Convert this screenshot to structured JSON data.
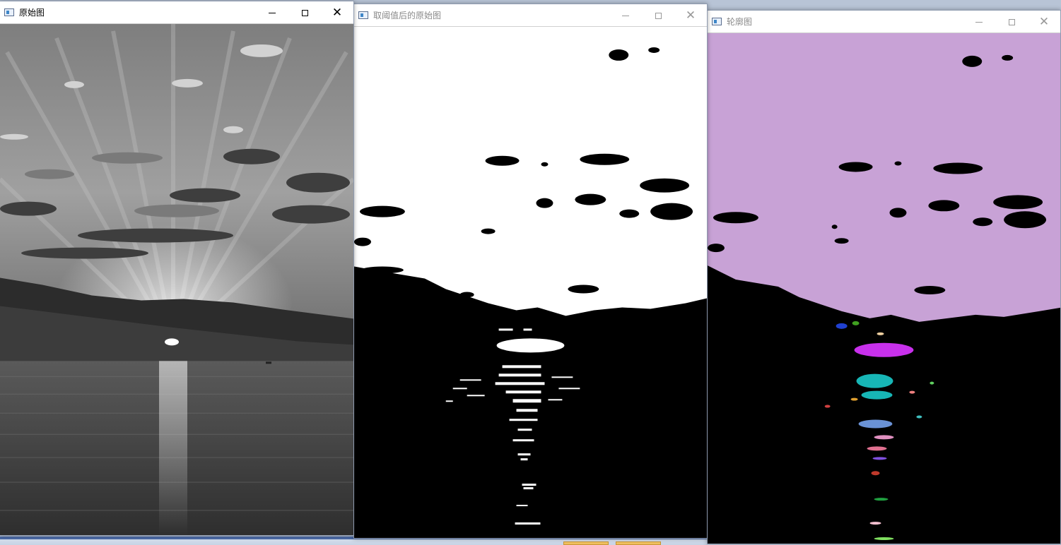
{
  "windows": [
    {
      "title": "原始图",
      "state": "active",
      "content": "grayscale-sunset-photo"
    },
    {
      "title": "取阈值后的原始图",
      "state": "inactive",
      "content": "binary-threshold-image"
    },
    {
      "title": "轮廓图",
      "state": "inactive",
      "content": "contour-colored-image"
    }
  ],
  "controls": {
    "minimize": "—",
    "maximize": "☐",
    "close": "✕"
  },
  "icons": {
    "app": "app-window-icon",
    "minimize": "minimize-icon",
    "maximize": "maximize-icon",
    "close": "close-icon"
  },
  "colors": {
    "contour_sky": "#c8a2d6",
    "contour_sun": "#c830ec",
    "contour_reflection": "#17b6b6",
    "contour_blue": "#6a92d6",
    "threshold_white": "#ffffff",
    "background_black": "#000000"
  }
}
